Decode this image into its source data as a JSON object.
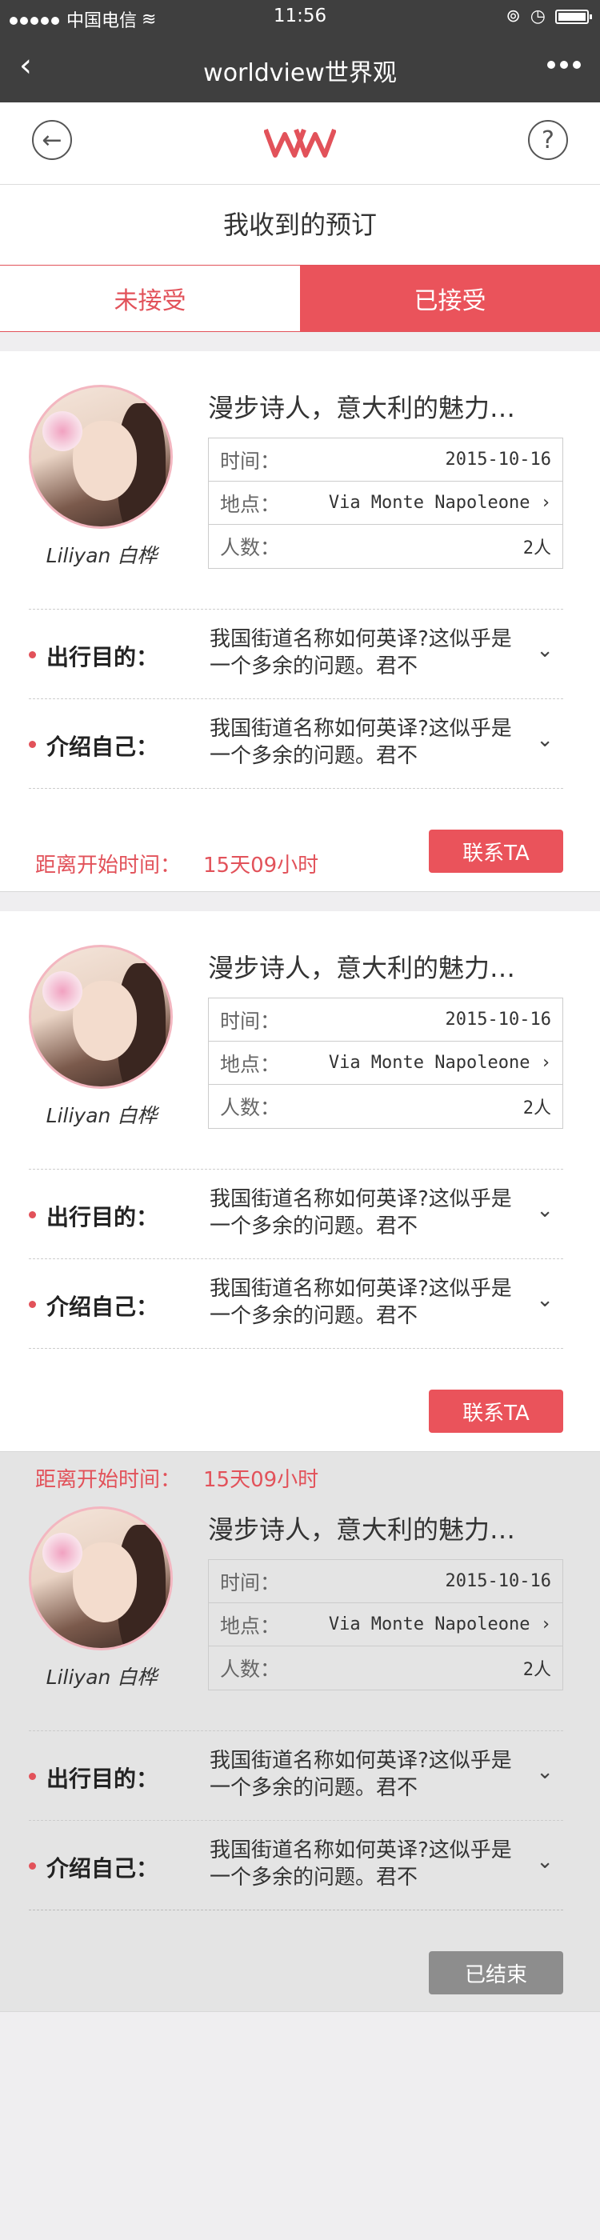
{
  "status_bar": {
    "carrier": "中国电信",
    "time": "11:56"
  },
  "nav": {
    "title": "worldview世界观"
  },
  "page_title": "我收到的预订",
  "tabs": [
    {
      "label": "未接受",
      "active": false
    },
    {
      "label": "已接受",
      "active": true
    }
  ],
  "cards": [
    {
      "name": "Liliyan 白桦",
      "title": "漫步诗人，意大利的魅力…",
      "time_label": "时间：",
      "time_value": "2015-10-16",
      "place_label": "地点：",
      "place_value": "Via Monte Napoleone",
      "people_label": "人数：",
      "people_value": "2人",
      "purpose_label": "出行目的：",
      "purpose_text": "我国街道名称如何英译?这似乎是一个多余的问题。君不",
      "intro_label": "介绍自己：",
      "intro_text": "我国街道名称如何英译?这似乎是一个多余的问题。君不",
      "countdown_label": "距离开始时间：",
      "countdown_value": "15天09小时",
      "button_label": "联系TA"
    },
    {
      "name": "Liliyan 白桦",
      "title": "漫步诗人，意大利的魅力…",
      "time_label": "时间：",
      "time_value": "2015-10-16",
      "place_label": "地点：",
      "place_value": "Via Monte Napoleone",
      "people_label": "人数：",
      "people_value": "2人",
      "purpose_label": "出行目的：",
      "purpose_text": "我国街道名称如何英译?这似乎是一个多余的问题。君不",
      "intro_label": "介绍自己：",
      "intro_text": "我国街道名称如何英译?这似乎是一个多余的问题。君不",
      "countdown_label": "距离开始时间：",
      "countdown_value": "15天09小时",
      "button_label": "联系TA"
    },
    {
      "name": "Liliyan 白桦",
      "title": "漫步诗人，意大利的魅力…",
      "time_label": "时间：",
      "time_value": "2015-10-16",
      "place_label": "地点：",
      "place_value": "Via Monte Napoleone",
      "people_label": "人数：",
      "people_value": "2人",
      "purpose_label": "出行目的：",
      "purpose_text": "我国街道名称如何英译?这似乎是一个多余的问题。君不",
      "intro_label": "介绍自己：",
      "intro_text": "我国街道名称如何英译?这似乎是一个多余的问题。君不",
      "button_label": "已结束"
    }
  ],
  "colors": {
    "accent": "#ea535b",
    "nav_bg": "#3f3f3f",
    "ended_bg": "#e4e4e4",
    "ended_button": "#8d8d8d"
  }
}
